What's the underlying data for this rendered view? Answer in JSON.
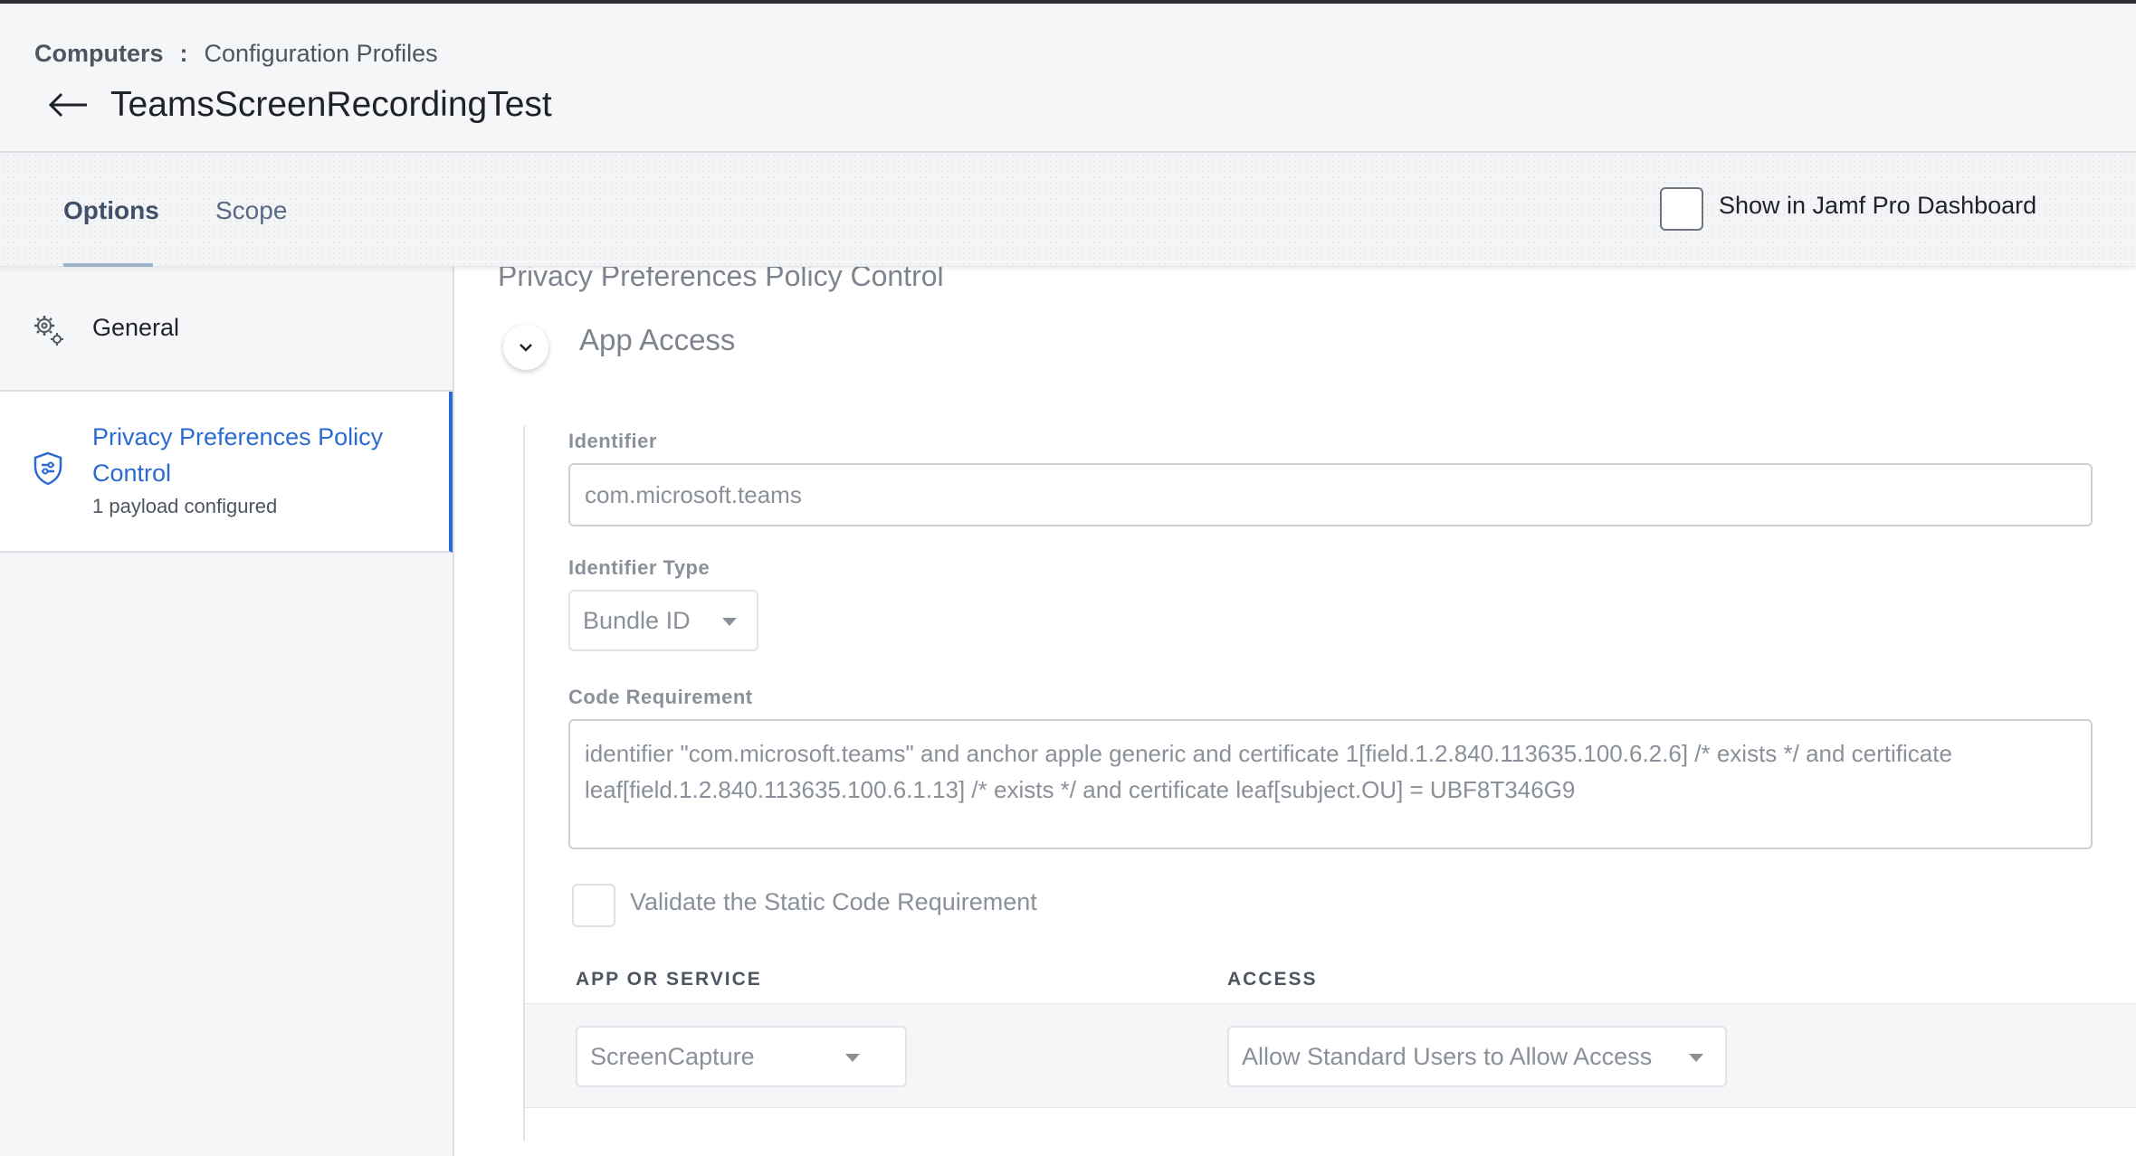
{
  "breadcrumb": {
    "root": "Computers",
    "separator": ":",
    "current": "Configuration Profiles"
  },
  "header": {
    "title": "TeamsScreenRecordingTest"
  },
  "tabs": [
    {
      "label": "Options",
      "active": true
    },
    {
      "label": "Scope",
      "active": false
    }
  ],
  "dashboard": {
    "label": "Show in Jamf Pro Dashboard",
    "checked": false
  },
  "sidebar": {
    "items": [
      {
        "label": "General",
        "icon": "gear-icon",
        "selected": false
      },
      {
        "label": "Privacy Preferences Policy Control",
        "sublabel": "1 payload configured",
        "icon": "shield-icon",
        "selected": true
      }
    ]
  },
  "main": {
    "section_title": "Privacy Preferences Policy Control",
    "subsection_title": "App Access",
    "identifier": {
      "label": "Identifier",
      "value": "com.microsoft.teams"
    },
    "identifier_type": {
      "label": "Identifier Type",
      "value": "Bundle ID"
    },
    "code_requirement": {
      "label": "Code Requirement",
      "value": "identifier \"com.microsoft.teams\" and anchor apple generic and certificate 1[field.1.2.840.113635.100.6.2.6] /* exists */ and certificate leaf[field.1.2.840.113635.100.6.1.13] /* exists */ and certificate leaf[subject.OU] = UBF8T346G9"
    },
    "validate": {
      "label": "Validate the Static Code Requirement",
      "checked": false
    },
    "table": {
      "columns": [
        "APP OR SERVICE",
        "ACCESS"
      ],
      "rows": [
        {
          "service": "ScreenCapture",
          "access": "Allow Standard Users to Allow Access"
        }
      ]
    }
  },
  "colors": {
    "accent": "#2b6bcf",
    "tab_underline": "#9fb3cc",
    "muted_text": "#8a9099"
  }
}
